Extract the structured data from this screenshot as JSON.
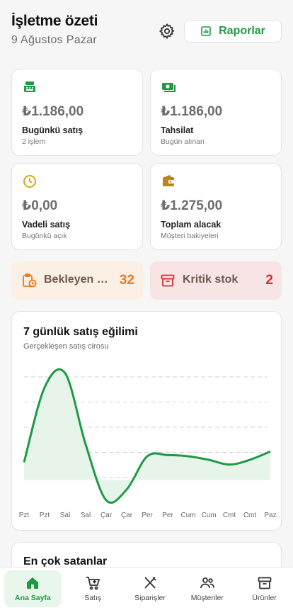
{
  "header": {
    "title": "İşletme özeti",
    "subtitle": "9 Ağustos Pazar",
    "reports_label": "Raporlar"
  },
  "stats": [
    {
      "icon": "cash-register-icon",
      "value": "₺1.186,00",
      "label": "Bugünkü satış",
      "sub": "2 işlem"
    },
    {
      "icon": "money-icon",
      "value": "₺1.186,00",
      "label": "Tahsilat",
      "sub": "Bugün alınan"
    },
    {
      "icon": "clock-icon",
      "value": "₺0,00",
      "label": "Vadeli satış",
      "sub": "Bugünkü açık"
    },
    {
      "icon": "wallet-icon",
      "value": "₺1.275,00",
      "label": "Toplam alacak",
      "sub": "Müşteri bakiyeleri"
    }
  ],
  "alerts": {
    "pending": {
      "label": "Bekleyen siparişler",
      "count": "32"
    },
    "critical": {
      "label": "Kritik stok",
      "count": "2"
    }
  },
  "chart_data": {
    "type": "area",
    "title": "7 günlük satış eğilimi",
    "subtitle": "Gerçekleşen satış cirosu",
    "x_labels": [
      "Pzt",
      "Pzt",
      "Sal",
      "Sal",
      "Çar",
      "Çar",
      "Per",
      "Per",
      "Cum",
      "Cum",
      "Cmt",
      "Cmt",
      "Paz"
    ],
    "values": [
      0.15,
      0.78,
      0.9,
      0.3,
      -0.17,
      -0.08,
      0.2,
      0.21,
      0.2,
      0.17,
      0.13,
      0.17,
      0.24
    ],
    "ylim": [
      -0.2,
      1.0
    ],
    "grid": true,
    "colors": {
      "line": "#1e9a45",
      "fill": "#e6f4e9"
    }
  },
  "top_sellers": {
    "title": "En çok satanlar"
  },
  "nav": [
    {
      "icon": "home-icon",
      "label": "Ana Sayfa",
      "active": true
    },
    {
      "icon": "cart-icon",
      "label": "Satış"
    },
    {
      "icon": "utensils-icon",
      "label": "Siparişler"
    },
    {
      "icon": "users-icon",
      "label": "Müşteriler"
    },
    {
      "icon": "archive-icon",
      "label": "Ürünler"
    }
  ],
  "colors": {
    "accent": "#1e9a45",
    "orange": "#ea7a1c",
    "red": "#d62d35",
    "yellow": "#d9a919"
  }
}
